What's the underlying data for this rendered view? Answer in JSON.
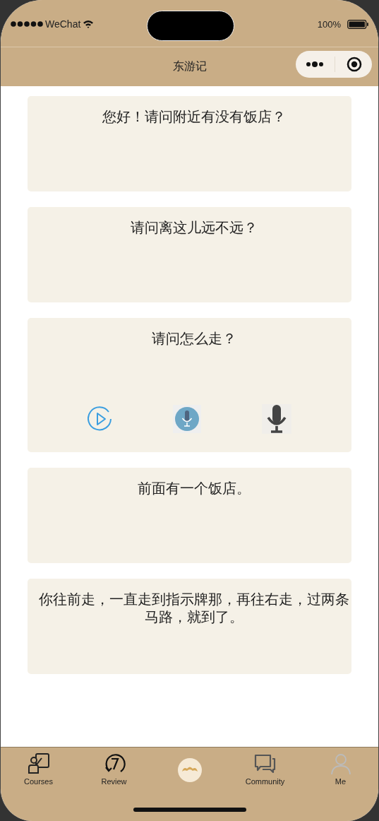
{
  "status_bar": {
    "carrier": "WeChat",
    "battery": "100%"
  },
  "nav_bar": {
    "title": "东游记"
  },
  "cards": [
    {
      "text": "您好！请问附近有没有饭店？"
    },
    {
      "text": "请问离这儿远不远？"
    },
    {
      "text": "请问怎么走？",
      "controls": [
        {
          "kind": "play"
        },
        {
          "kind": "record"
        },
        {
          "kind": "mic"
        }
      ]
    },
    {
      "text": "前面有一个饭店。"
    },
    {
      "text": "你往前走，一直走到指示牌那，再往右走，过两条马路，就到了。"
    }
  ],
  "tab_bar": [
    {
      "kind": "courses",
      "label": "Courses"
    },
    {
      "kind": "review",
      "label": "Review"
    },
    {
      "kind": "logo"
    },
    {
      "kind": "community",
      "label": "Community"
    },
    {
      "kind": "me",
      "label": "Me"
    }
  ]
}
